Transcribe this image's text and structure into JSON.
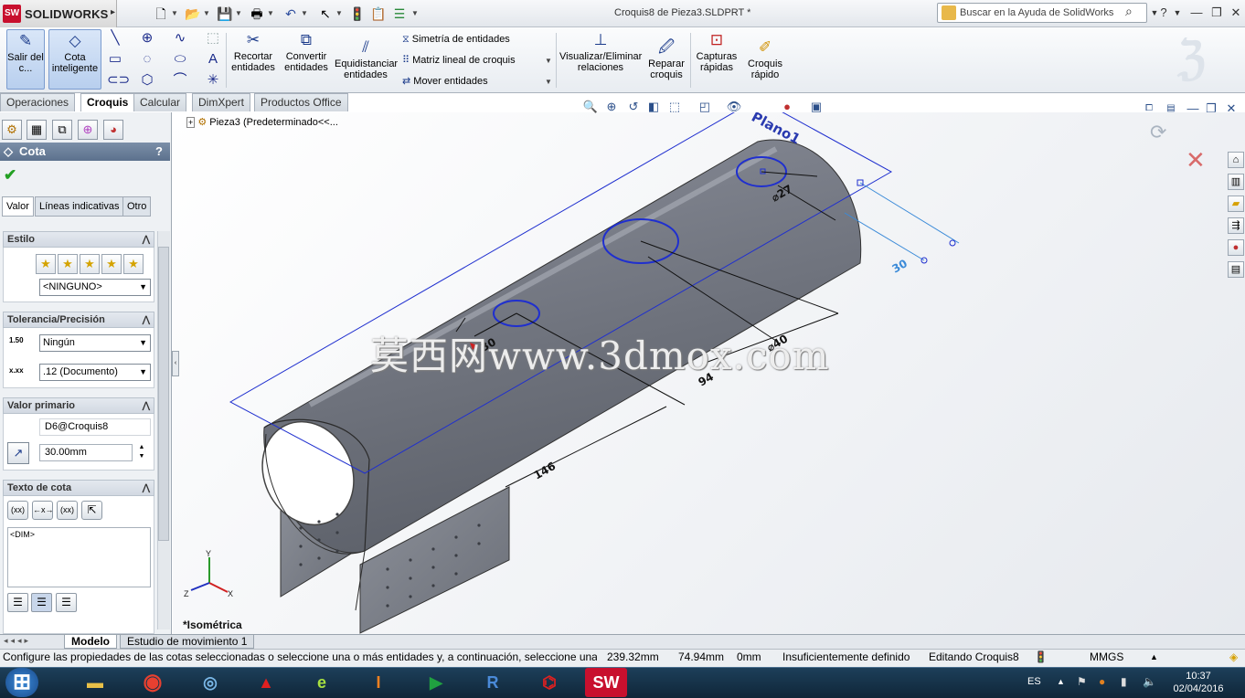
{
  "app": {
    "brand": "SOLIDWORKS",
    "badge": "SW",
    "document_title": "Croquis8 de Pieza3.SLDPRT *"
  },
  "help_search": {
    "placeholder": "Buscar en la Ayuda de SolidWorks"
  },
  "commands": {
    "exit_sketch": "Salir del c...",
    "smart_dimension": "Cota inteligente",
    "trim": "Recortar entidades",
    "convert": "Convertir entidades",
    "offset": "Equidistanciar entidades",
    "mirror": "Simetría de entidades",
    "linear_pattern": "Matriz lineal de croquis",
    "move": "Mover entidades",
    "display_relations": "Visualizar/Eliminar relaciones",
    "repair_sketch": "Reparar croquis",
    "quick_snaps": "Capturas rápidas",
    "rapid_sketch": "Croquis rápido"
  },
  "tabs": [
    "Operaciones",
    "Croquis",
    "Calcular",
    "DimXpert",
    "Productos Office"
  ],
  "active_tab": "Croquis",
  "property_manager": {
    "title": "Cota",
    "help": "?",
    "subtabs": [
      "Valor",
      "Líneas indicativas",
      "Otro"
    ],
    "style": {
      "header": "Estilo",
      "value": "<NINGUNO>"
    },
    "tolerance": {
      "header": "Tolerancia/Precisión",
      "tolerance_type": "Ningún",
      "precision": ".12 (Documento)",
      "tol_icon": "1.50",
      "prec_icon": "x.xx"
    },
    "primary_value": {
      "header": "Valor primario",
      "name": "D6@Croquis8",
      "value": "30.00mm"
    },
    "dim_text": {
      "header": "Texto de cota",
      "text": "<DIM>",
      "btn_xx": "(xx)",
      "btn_center": "←x→",
      "btn_xx2": "(xx)"
    }
  },
  "tree": {
    "root": "Pieza3  (Predeterminado<<..."
  },
  "viewport": {
    "view_label": "*Isométrica",
    "watermark": "莫西网www.3dmox.com",
    "plane_label": "Plano1",
    "dims": {
      "d27": "⌀27",
      "d40": "⌀40",
      "d94": "94",
      "d146": "146",
      "d30": "30",
      "d30b": "30"
    },
    "triad": {
      "x": "X",
      "y": "Y",
      "z": "Z"
    }
  },
  "bottom_tabs": [
    "Modelo",
    "Estudio de movimiento 1"
  ],
  "status": {
    "message": "Configure las propiedades de las cotas seleccionadas o seleccione una o más entidades y, a continuación, seleccione una ...",
    "x": "239.32mm",
    "y": "74.94mm",
    "z": "0mm",
    "definition": "Insuficientemente definido",
    "editing": "Editando Croquis8",
    "units": "MMGS"
  },
  "taskbar": {
    "language": "ES",
    "time": "10:37",
    "date": "02/04/2016"
  },
  "colors": {
    "accent": "#1a3a8a",
    "sketch": "#1f2fcf",
    "model": "#8a8e98",
    "title_bar": "#5c718d"
  }
}
